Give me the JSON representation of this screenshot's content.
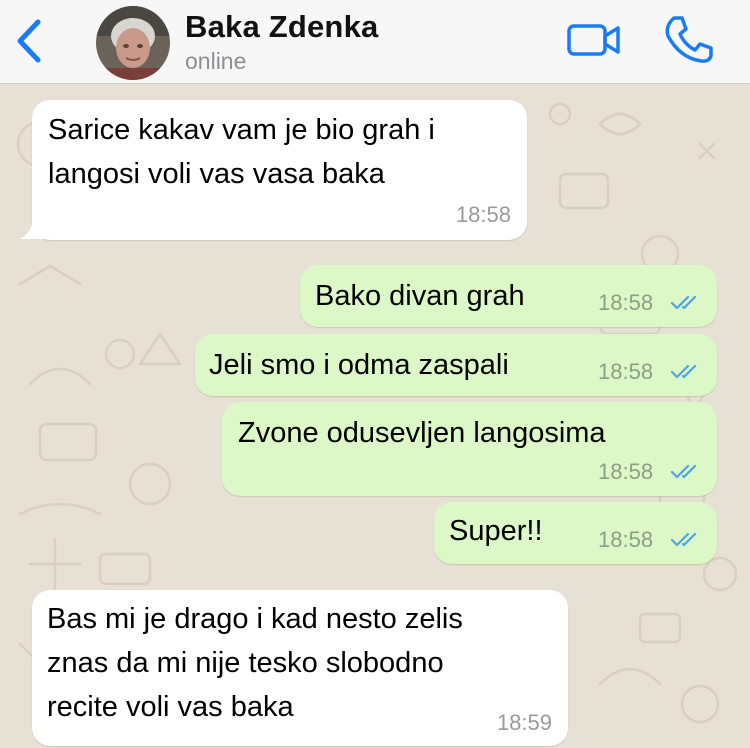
{
  "header": {
    "back_icon": "chevron-left-icon",
    "contact_name": "Baka Zdenka",
    "status": "online",
    "video_icon": "video-camera-icon",
    "call_icon": "phone-icon",
    "accent_color": "#1a7cf5"
  },
  "messages": [
    {
      "direction": "incoming",
      "text": "Sarice kakav vam je bio grah i\nlangosi voli vas vasa baka",
      "time": "18:58"
    },
    {
      "direction": "outgoing",
      "text": "Bako divan grah",
      "time": "18:58",
      "status": "read"
    },
    {
      "direction": "outgoing",
      "text": "Jeli smo i odma zaspali",
      "time": "18:58",
      "status": "read"
    },
    {
      "direction": "outgoing",
      "text": "Zvone odusevljen langosima",
      "time": "18:58",
      "status": "read"
    },
    {
      "direction": "outgoing",
      "text": "Super!!",
      "time": "18:58",
      "status": "read"
    },
    {
      "direction": "incoming",
      "text": "Bas mi je drago i kad nesto zelis\nznas da mi nije tesko slobodno\nrecite voli vas baka",
      "time": "18:59"
    }
  ],
  "colors": {
    "incoming_bubble": "#ffffff",
    "outgoing_bubble": "#dcf8c6",
    "read_ticks": "#4fa3e8",
    "wallpaper": "#e7e0d4"
  }
}
